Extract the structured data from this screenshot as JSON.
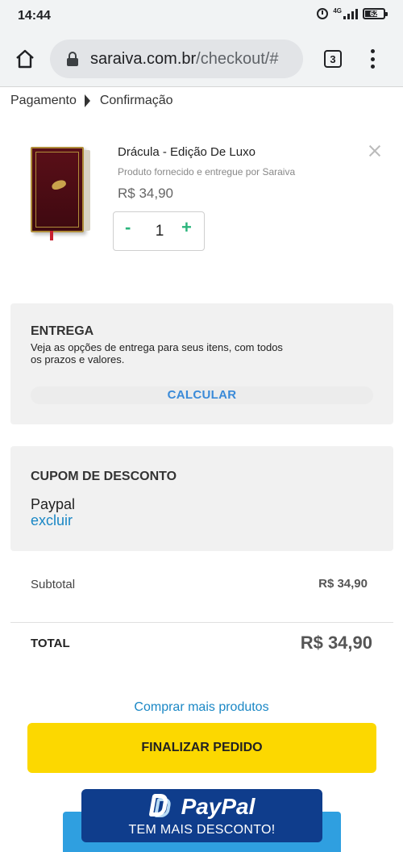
{
  "status_bar": {
    "time": "14:44",
    "network_label": "4G",
    "battery_level": "62"
  },
  "browser": {
    "url_domain": "saraiva.com.br",
    "url_path": "/checkout/#",
    "tab_count": "3"
  },
  "breadcrumb": {
    "items": [
      "Pagamento",
      "Confirmação"
    ]
  },
  "cart": {
    "item": {
      "name": "Drácula - Edição De Luxo",
      "seller": "Produto fornecido e entregue por Saraiva",
      "price": "R$ 34,90",
      "quantity": "1",
      "minus_label": "-",
      "plus_label": "+"
    }
  },
  "delivery": {
    "title": "ENTREGA",
    "description": "Veja as opções de entrega para seus itens, com todos os prazos e valores.",
    "calculate_label": "CALCULAR"
  },
  "coupon": {
    "title": "CUPOM DE DESCONTO",
    "code": "Paypal",
    "remove_label": "excluir"
  },
  "totals": {
    "subtotal_label": "Subtotal",
    "subtotal_value": "R$ 34,90",
    "total_label": "TOTAL",
    "total_value": "R$ 34,90"
  },
  "actions": {
    "continue_shopping": "Comprar mais produtos",
    "checkout": "FINALIZAR PEDIDO"
  },
  "paypal_banner": {
    "brand": "PayPal",
    "tagline": "TEM MAIS DESCONTO!"
  },
  "colors": {
    "accent_green": "#2bb57c",
    "link_blue": "#1a87c5",
    "checkout_yellow": "#fcd800",
    "paypal_navy": "#0f3d8c",
    "paypal_sky": "#2f9fe0"
  }
}
